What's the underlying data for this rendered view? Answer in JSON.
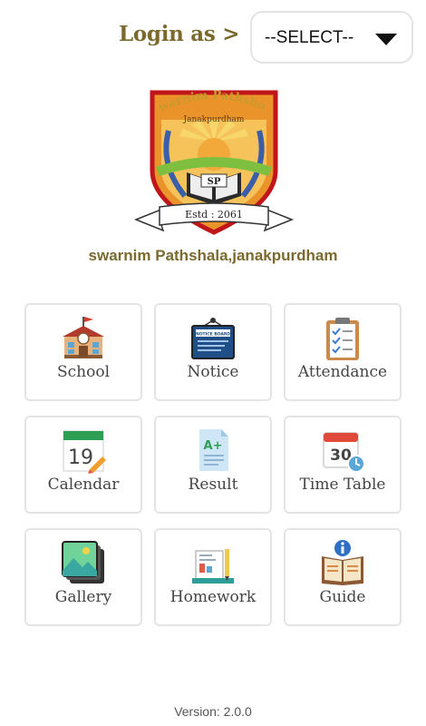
{
  "header": {
    "login_label": "Login as >",
    "select": {
      "selected": "--SELECT--",
      "icon": "caret-down-icon"
    }
  },
  "logo": {
    "banner_text": "Swarnim Pathshala",
    "sub_text": "Janakpurdham",
    "monogram": "SP",
    "estd_text": "Estd : 2061",
    "colors": {
      "shield": "#e9932a",
      "border": "#c0151b",
      "laurel": "#3a5fa8",
      "ribbon": "#7fbf3f"
    }
  },
  "school_name": "swarnim Pathshala,janakpurdham",
  "menu": [
    {
      "label": "School",
      "icon": "school-building-icon"
    },
    {
      "label": "Notice",
      "icon": "notice-board-icon"
    },
    {
      "label": "Attendance",
      "icon": "clipboard-checklist-icon"
    },
    {
      "label": "Calendar",
      "icon": "calendar-icon"
    },
    {
      "label": "Result",
      "icon": "result-document-icon"
    },
    {
      "label": "Time Table",
      "icon": "timetable-clock-icon"
    },
    {
      "label": "Gallery",
      "icon": "gallery-image-icon"
    },
    {
      "label": "Homework",
      "icon": "homework-books-icon"
    },
    {
      "label": "Guide",
      "icon": "guide-info-book-icon"
    }
  ],
  "notice_icon_text": "NOTICE BOARD",
  "calendar_icon_text": "19",
  "timetable_icon_text": "30",
  "result_icon_text": "A+",
  "version": "Version: 2.0.0",
  "colors": {
    "accent_text": "#7a6a2e",
    "tile_border": "#e4e4e4"
  }
}
